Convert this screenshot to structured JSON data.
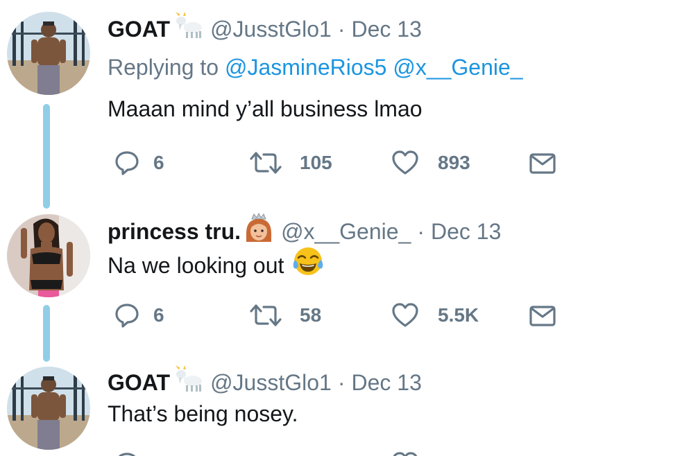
{
  "tweets": [
    {
      "display_name": "GOAT",
      "name_emoji": "goat-emoji",
      "handle": "@JusstGlo1",
      "separator": "·",
      "date": "Dec 13",
      "replying_prefix": "Replying to",
      "replying_to": [
        "@JasmineRios5",
        "@x__Genie_"
      ],
      "text": "Maaan mind y’all business lmao",
      "stats": {
        "replies": "6",
        "retweets": "105",
        "likes": "893"
      }
    },
    {
      "display_name": "princess tru.",
      "name_emoji": "princess-emoji",
      "handle": "@x__Genie_",
      "separator": "·",
      "date": "Dec 13",
      "text": "Na we looking out",
      "text_emoji": "tears-of-joy-emoji",
      "stats": {
        "replies": "6",
        "retweets": "58",
        "likes": "5.5K"
      }
    },
    {
      "display_name": "GOAT",
      "name_emoji": "goat-emoji",
      "handle": "@JusstGlo1",
      "separator": "·",
      "date": "Dec 13",
      "text": "That’s being nosey."
    }
  ],
  "colors": {
    "text": "#14171a",
    "secondary": "#657786",
    "link": "#1b95e0",
    "thread_line": "#90cee6"
  }
}
